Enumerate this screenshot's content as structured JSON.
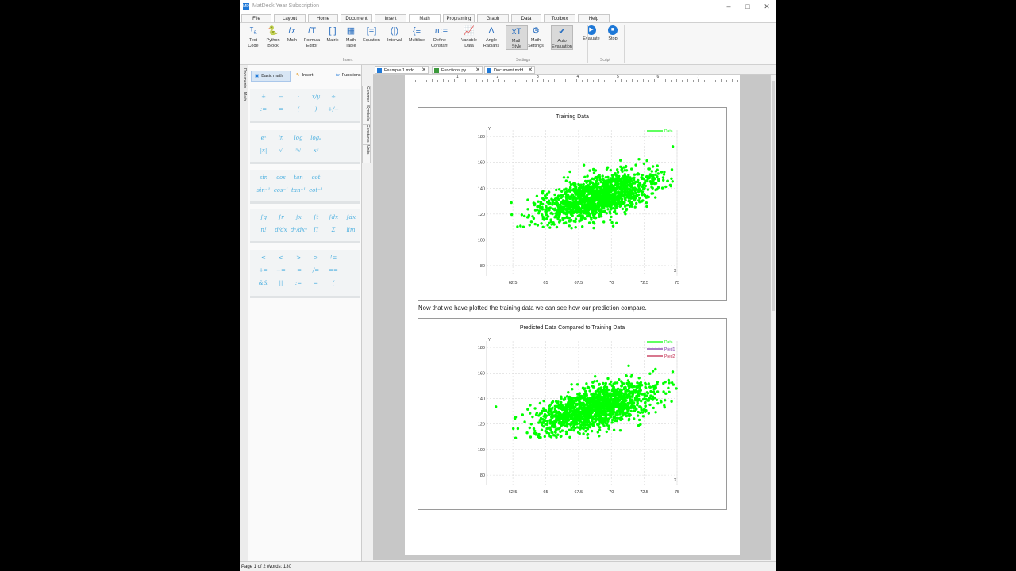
{
  "window": {
    "title": "MatDeck Year Subscription",
    "logo": "MD"
  },
  "menus": [
    "File",
    "Layout",
    "Home",
    "Document",
    "Insert",
    "Math",
    "Programing",
    "Graph",
    "Data",
    "Toolbox",
    "Help"
  ],
  "active_menu": "Math",
  "ribbon": {
    "insert_buttons": [
      {
        "label": "Text\nCode",
        "icon": "text-code-icon",
        "glyph": "ᵀₐ"
      },
      {
        "label": "Python\nBlock",
        "icon": "python-icon",
        "glyph": "🐍"
      },
      {
        "label": "Math",
        "icon": "math-fx-icon",
        "glyph": "𝑓𝑥"
      },
      {
        "label": "Formula\nEditor",
        "icon": "formula-editor-icon",
        "glyph": "𝑓T"
      },
      {
        "label": "Matrix",
        "icon": "matrix-icon",
        "glyph": "[ ]"
      },
      {
        "label": "Math\nTable",
        "icon": "math-table-icon",
        "glyph": "▦"
      },
      {
        "label": "Equation",
        "icon": "equation-icon",
        "glyph": "[=]"
      },
      {
        "label": "Interval",
        "icon": "interval-icon",
        "glyph": "(|)"
      },
      {
        "label": "Multiline",
        "icon": "multiline-icon",
        "glyph": "{≡"
      },
      {
        "label": "Define\nConstant",
        "icon": "pi-icon",
        "glyph": "π:="
      }
    ],
    "settings_buttons": [
      {
        "label": "Variable\nData",
        "icon": "variable-data-icon",
        "glyph": "📈"
      },
      {
        "label": "Angle\nRadians",
        "icon": "angle-icon",
        "glyph": "∆"
      },
      {
        "label": "Math\nStyle",
        "icon": "math-style-icon",
        "glyph": "xT"
      },
      {
        "label": "Math\nSettings",
        "icon": "math-settings-icon",
        "glyph": "⚙"
      },
      {
        "label": "Auto\nEvaluation",
        "icon": "auto-evaluation-icon",
        "glyph": "✔"
      }
    ],
    "script_buttons": [
      {
        "label": "Evaluate",
        "icon": "play-icon",
        "glyph": "▶"
      },
      {
        "label": "Stop",
        "icon": "stop-icon",
        "glyph": "■"
      }
    ],
    "groups": {
      "insert": "Insert",
      "settings": "Settings",
      "script": "Script"
    }
  },
  "side_tabs": [
    "Documents",
    "Math"
  ],
  "panel": {
    "tabs": [
      "Basic math",
      "Insert",
      "Functions"
    ],
    "right_tabs": [
      "Common",
      "Symbols",
      "Constants",
      "Units"
    ],
    "groups": [
      {
        "rows": [
          [
            "+",
            "−",
            "·",
            "x/y",
            "÷"
          ],
          [
            ":=",
            "=",
            "(",
            ")",
            "+/−"
          ]
        ]
      },
      {
        "rows": [
          [
            "eˣ",
            "ln",
            "log",
            "logₐ"
          ],
          [
            "|x|",
            "√",
            "ⁿ√",
            "xʸ"
          ]
        ]
      },
      {
        "rows": [
          [
            "sin",
            "cos",
            "tan",
            "cot"
          ],
          [
            "sin⁻¹",
            "cos⁻¹",
            "tan⁻¹",
            "cot⁻¹"
          ]
        ]
      },
      {
        "rows": [
          [
            "∫g",
            "∫r",
            "∫x",
            "∫t",
            "∫dx",
            "∫dx"
          ],
          [
            "n!",
            "d/dx",
            "dⁿ/dxⁿ",
            "Π",
            "Σ",
            "lim"
          ]
        ]
      },
      {
        "rows": [
          [
            "≤",
            "<",
            ">",
            "≥",
            "!="
          ],
          [
            "+=",
            "−=",
            "·=",
            "/=",
            "=="
          ],
          [
            "&&",
            "||",
            ":=",
            "=",
            "("
          ]
        ]
      }
    ]
  },
  "doc_tabs": [
    "Example 1.mdd",
    "Functions.py",
    "Document.mdd"
  ],
  "ruler_labels": [
    "1",
    "2",
    "3",
    "4",
    "5",
    "6",
    "7"
  ],
  "body_text": "Now that we have plotted the training data we can see how our prediction compare.",
  "status": "Page 1 of 2   Words: 130",
  "colors": {
    "accent": "#1e78d7",
    "scatter": "#00ff00",
    "pred1": "#7b2fa8",
    "pred2": "#c0264a"
  },
  "chart_data": [
    {
      "type": "scatter",
      "title": "Training Data",
      "xlabel": "X",
      "ylabel": "Y",
      "xticks": [
        62.5,
        65,
        67.5,
        70,
        72.5,
        75
      ],
      "yticks": [
        80,
        100,
        120,
        140,
        160,
        180
      ],
      "xlim": [
        60.5,
        75
      ],
      "ylim": [
        72,
        185
      ],
      "grid": true,
      "legend_position": "top-right",
      "series": [
        {
          "name": "Data",
          "color": "#00ff00",
          "center_x": 68.8,
          "center_y": 133,
          "sx": 2.2,
          "sy": 9.5,
          "corr": 0.55,
          "y_floor": 109,
          "n": 1500
        }
      ]
    },
    {
      "type": "scatter",
      "title": "Predicted Data Compared to Training Data",
      "xlabel": "X",
      "ylabel": "Y",
      "xticks": [
        62.5,
        65,
        67.5,
        70,
        72.5,
        75
      ],
      "yticks": [
        80,
        100,
        120,
        140,
        160,
        180
      ],
      "xlim": [
        60.5,
        75
      ],
      "ylim": [
        72,
        185
      ],
      "grid": true,
      "legend_position": "top-right",
      "series": [
        {
          "name": "Data",
          "color": "#00ff00",
          "center_x": 68.8,
          "center_y": 133,
          "sx": 2.2,
          "sy": 9.5,
          "corr": 0.55,
          "y_floor": 109,
          "n": 1500
        },
        {
          "name": "Pred1",
          "color": "#7b2fa8"
        },
        {
          "name": "Pred2",
          "color": "#c0264a"
        }
      ]
    }
  ]
}
